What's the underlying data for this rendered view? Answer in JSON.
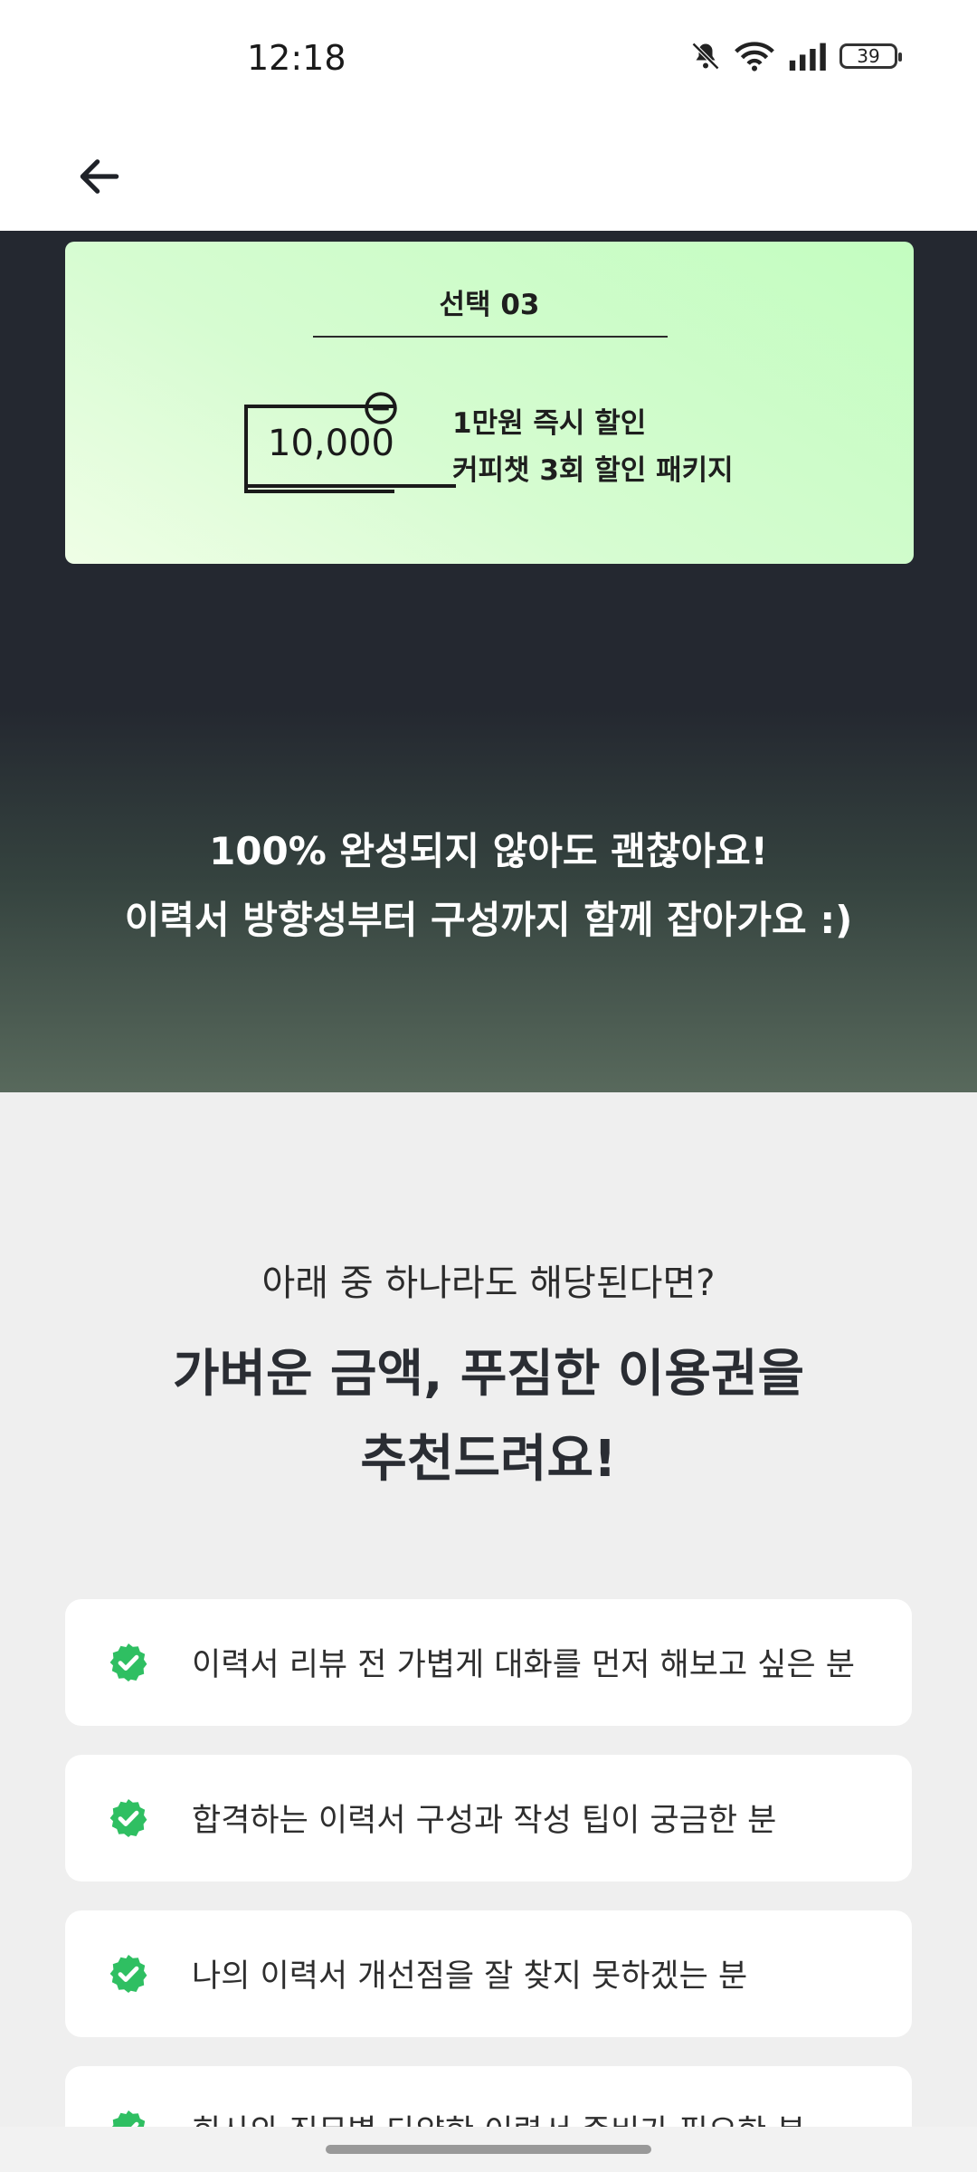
{
  "status_bar": {
    "time": "12:18",
    "battery": "39",
    "icons": [
      "mute-icon",
      "wifi-icon",
      "signal-icon",
      "battery-icon"
    ]
  },
  "app_bar": {
    "back_icon": "arrow-left-icon"
  },
  "promo": {
    "title": "선택 03",
    "coupon_value": "10,000",
    "line1": "1만원 즉시 할인",
    "line2": "커피챗 3회 할인 패키지"
  },
  "headline": {
    "line1": "100% 완성되지 않아도 괜찮아요!",
    "line2": "이력서 방향성부터 구성까지 함께 잡아가요 :)"
  },
  "recommend": {
    "question": "아래 중 하나라도 해당된다면?",
    "title_line1": "가벼운 금액, 푸짐한 이용권을",
    "title_line2": "추천드려요!",
    "items": [
      "이력서 리뷰 전 가볍게 대화를 먼저 해보고 싶은 분",
      "합격하는 이력서 구성과 작성 팁이 궁금한 분",
      "나의 이력서 개선점을 잘 찾지 못하겠는 분",
      "회사와 직무별 다양한 이력서 준비가 필요한 분"
    ]
  },
  "colors": {
    "accent_green": "#2fbf62",
    "dark_bg": "#242830",
    "promo_card": "#c8fdc3"
  }
}
